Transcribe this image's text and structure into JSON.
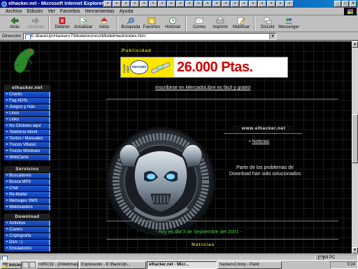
{
  "window": {
    "title": "elhacker.net - Microsoft Internet Explorer proporcio",
    "icon": "ie-icon"
  },
  "menu": [
    "Archivo",
    "Edición",
    "Ver",
    "Favoritos",
    "Herramientas",
    "Ayuda"
  ],
  "toolbar": {
    "back": "Atrás",
    "forward": "Adelante",
    "stop": "Detener",
    "refresh": "Actualizar",
    "home": "Inicio",
    "search": "Búsqueda",
    "favorites": "Favoritos",
    "history": "Historial",
    "mail": "Correo",
    "print": "Imprimir",
    "edit": "Modificar",
    "discuss": "Discutir",
    "messenger": "Messenger"
  },
  "address": {
    "label": "Dirección",
    "value": "E:\\BackUp\\Hackerv7\\ModeloÚnico\\ModelHack\\index.htm"
  },
  "sidebar": {
    "section1_title": "elhacker.net",
    "section1_items": [
      "Cracks",
      "Faq ADSL",
      "Juegos y más",
      "Linux",
      "Links",
      "No Clickees aquí",
      "Telefonía Móvil",
      "Textos / Manuales",
      "Trucos VBasic",
      "Trucos Windows",
      "WebCams"
    ],
    "section2_title": "Servicios",
    "section2_items": [
      "Buscadores",
      "Busca MP3",
      "Chat",
      "Re-Mailer",
      "Mensajes SMS",
      "Webmasters"
    ],
    "section3_title": "Download",
    "section3_items": [
      "Antivirus",
      "Covers",
      "Criptografía",
      "Divx ;-)",
      "Emuladores"
    ]
  },
  "main": {
    "publicidad_label": "Publicidad",
    "banner": {
      "click_text": "CLICK AQUÍ",
      "logo_text": "mercado",
      "price": "26.000 Ptas."
    },
    "signup_link": "Inscribirse en MercadoLibre es fácil y gratis!",
    "site_box": "www.elhacker.net",
    "noticias_link": "Noticias",
    "news_text": "Parte de los problemas de Download han sido solucionados",
    "date_line": "- Hoy es dia 3 de Septiembre del 2001 -",
    "noticias_title": "Noticias"
  },
  "statusbar": {
    "main_text": "",
    "zone_text": "Mi PC"
  },
  "taskbar": {
    "start": "Inicio",
    "tasks": [
      {
        "label": "mIRC32 - [#Webmasters ]",
        "active": false
      },
      {
        "label": "Explorando - E:\\BackUp\\...",
        "active": false
      },
      {
        "label": "elhacker.net - Micr...",
        "active": true
      },
      {
        "label": "hackerv2.bmp - Paint",
        "active": false
      }
    ],
    "clock": "0:24"
  }
}
